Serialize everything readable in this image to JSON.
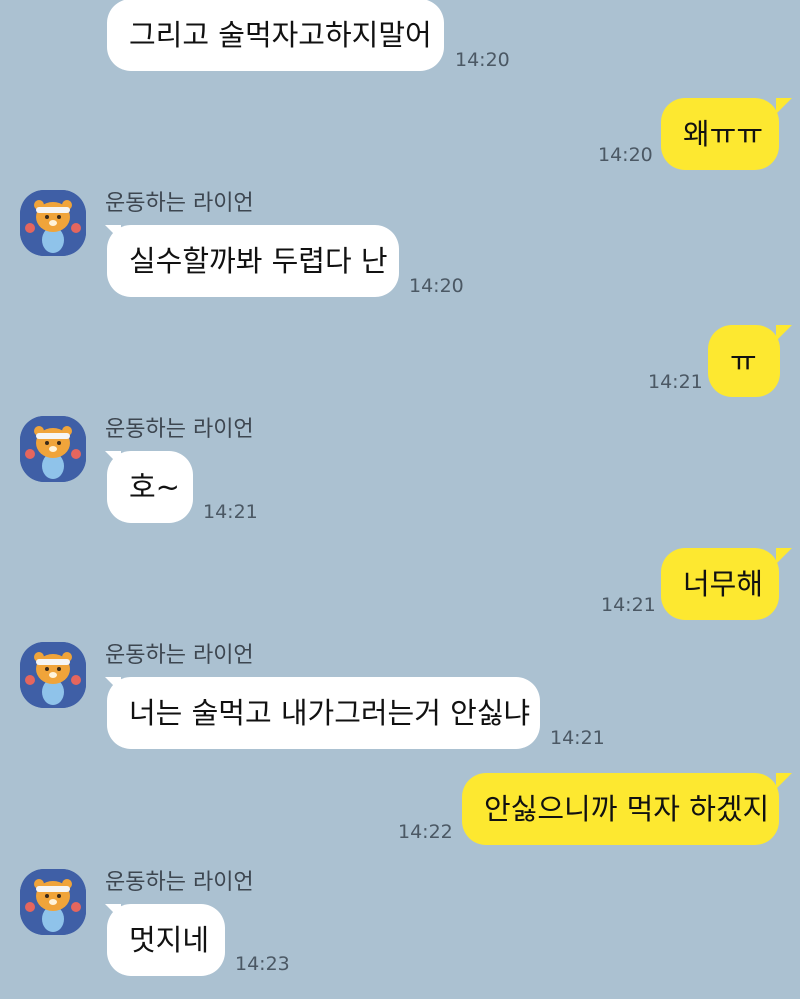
{
  "colors": {
    "background": "#abc1d1",
    "incoming_bubble": "#ffffff",
    "outgoing_bubble": "#fde830",
    "avatar_bg": "#3f5fa6"
  },
  "messages": [
    {
      "direction": "incoming",
      "text": "그리고 술먹자고하지말어",
      "time": "14:20"
    },
    {
      "direction": "outgoing",
      "text": "왜ㅠㅠ",
      "time": "14:20"
    },
    {
      "direction": "incoming",
      "sender": "운동하는 라이언",
      "avatar": "lion-avatar-icon",
      "text": "실수할까봐 두렵다 난",
      "time": "14:20"
    },
    {
      "direction": "outgoing",
      "text": "ㅠ",
      "time": "14:21"
    },
    {
      "direction": "incoming",
      "sender": "운동하는 라이언",
      "avatar": "lion-avatar-icon",
      "text": "호~",
      "time": "14:21"
    },
    {
      "direction": "outgoing",
      "text": "너무해",
      "time": "14:21"
    },
    {
      "direction": "incoming",
      "sender": "운동하는 라이언",
      "avatar": "lion-avatar-icon",
      "text": "너는 술먹고 내가그러는거 안싫냐",
      "time": "14:21"
    },
    {
      "direction": "outgoing",
      "text": "안싫으니까 먹자 하겠지",
      "time": "14:22"
    },
    {
      "direction": "incoming",
      "sender": "운동하는 라이언",
      "avatar": "lion-avatar-icon",
      "text": "멋지네",
      "time": "14:23"
    }
  ]
}
